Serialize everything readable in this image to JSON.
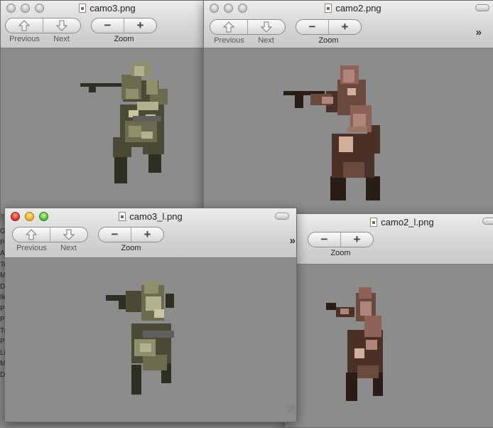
{
  "toolbar": {
    "previous_label": "Previous",
    "next_label": "Next",
    "zoom_label": "Zoom",
    "zoom_out_symbol": "−",
    "zoom_in_symbol": "+",
    "overflow_symbol": "»"
  },
  "windows": [
    {
      "id": "camo3",
      "title": "camo3.png",
      "active": false
    },
    {
      "id": "camo2",
      "title": "camo2.png",
      "active": false
    },
    {
      "id": "camo3_l",
      "title": "camo3_l.png",
      "active": true
    },
    {
      "id": "camo2_l",
      "title": "camo2_l.png",
      "active": false
    }
  ],
  "background_fragments": [
    "Gi",
    "Pr",
    "Ac",
    "Te",
    "Mo",
    "Dr",
    "Ik",
    "Pr",
    "Pa",
    "Tr",
    "Pic",
    "Lit",
    "Mu",
    "De"
  ],
  "colors": {
    "canvas_gray": "#8c8c8c",
    "green_camo": [
      "#2e2f22",
      "#4a4a35",
      "#6b6b50",
      "#8f8f6c",
      "#b2b190",
      "#c8c5a3",
      "#5f5f5f"
    ],
    "red_camo": [
      "#2a1d17",
      "#4a3027",
      "#6b4a3e",
      "#8e6258",
      "#b18479",
      "#d0b09b",
      "#9a7565"
    ]
  },
  "icons": {
    "previous": "up-arrow-icon",
    "next": "down-arrow-icon",
    "zoom_out": "minus-icon",
    "zoom_in": "plus-icon",
    "overflow": "double-chevron-icon",
    "document": "png-document-icon"
  }
}
